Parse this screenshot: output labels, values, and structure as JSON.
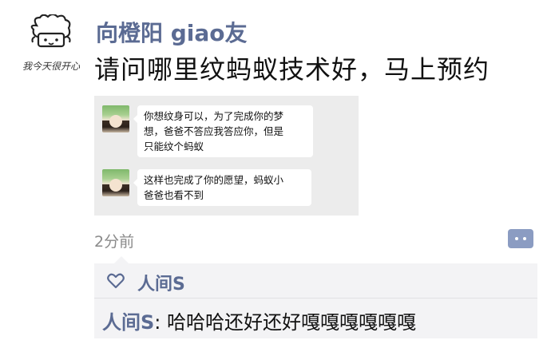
{
  "post": {
    "avatar_caption": "我今天很开心",
    "username": "向橙阳 giao友",
    "text": "请问哪里纹蚂蚁技术好，马上预约",
    "screenshot_messages": [
      "你想纹身可以，为了完成你的梦",
      "想，爸爸不答应我答应你，但是",
      "只能纹个蚂蚁",
      "这样也完成了你的愿望，蚂蚁小",
      "爸爸也看不到"
    ],
    "time": "2分前"
  },
  "likes": {
    "icon": "heart-icon",
    "names": "人间S"
  },
  "comments": [
    {
      "name": "人间S",
      "sep": ": ",
      "text": "哈哈哈还好还好嘎嘎嘎嘎嘎嘎"
    }
  ],
  "colors": {
    "link": "#5b6b93",
    "comment_button": "#8b9cc2",
    "panel_bg": "#f3f3f5"
  }
}
